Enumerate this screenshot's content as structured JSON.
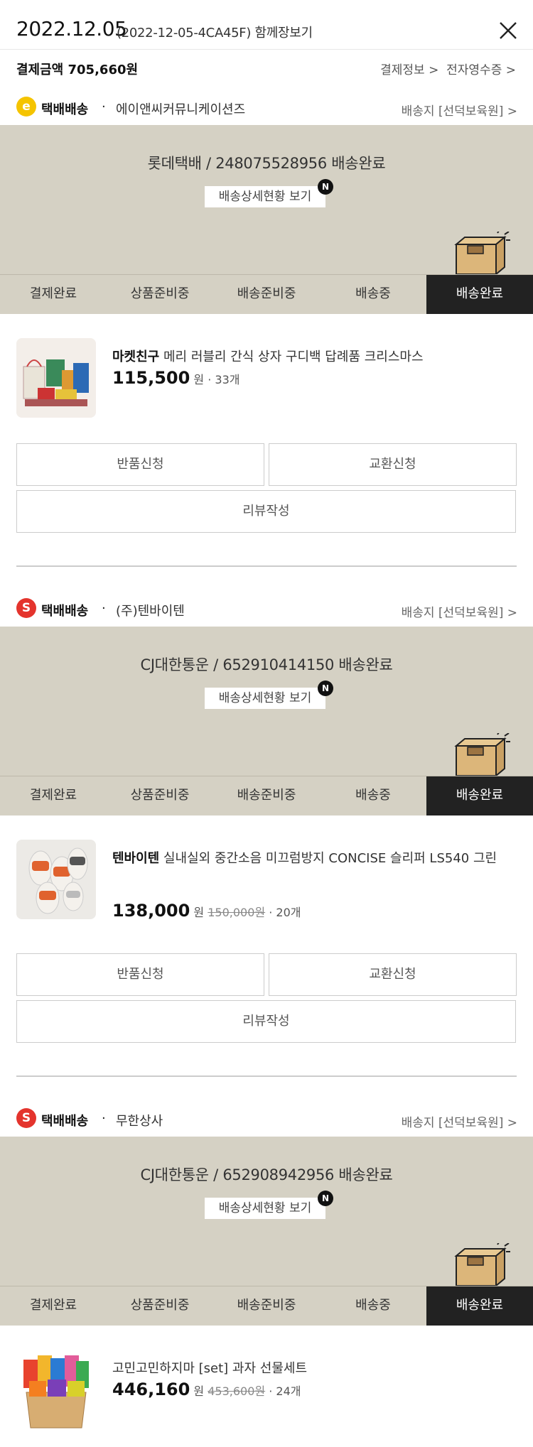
{
  "header": {
    "date": "2022.12.05",
    "order_ref": "(2022-12-05-4CA45F) 함께장보기",
    "pay_amount": "결제금액 705,660원",
    "pay_info_link": "결제정보 >",
    "receipt_link": "전자영수증 >"
  },
  "shipments": [
    {
      "badge": "e",
      "ship_type": "택배배송",
      "dot": "·",
      "vendor": "에이앤씨커뮤니케이션즈",
      "address": "배송지 [선덕보육원] >",
      "courier": "롯데택배 / 248075528956 배송완료",
      "detail_button": "배송상세현황 보기",
      "new_badge": "N",
      "steps": [
        "결제완료",
        "상품준비중",
        "배송준비중",
        "배송중",
        "배송완료"
      ],
      "product": {
        "brand": "마켓친구",
        "name": " 메리 러블리 간식 상자 구디백 답례품 크리스마스",
        "price": "115,500",
        "won": "원",
        "original": "",
        "qty": "· 33개"
      },
      "buttons": {
        "return": "반품신청",
        "exchange": "교환신청",
        "review": "리뷰작성"
      }
    },
    {
      "badge": "S",
      "ship_type": "택배배송",
      "dot": "·",
      "vendor": "(주)텐바이텐",
      "address": "배송지 [선덕보육원] >",
      "courier": "CJ대한통운 / 652910414150 배송완료",
      "detail_button": "배송상세현황 보기",
      "new_badge": "N",
      "steps": [
        "결제완료",
        "상품준비중",
        "배송준비중",
        "배송중",
        "배송완료"
      ],
      "product": {
        "brand": "텐바이텐",
        "name": " 실내실외 중간소음 미끄럼방지 CONCISE 슬리퍼 LS540 그린",
        "price": "138,000",
        "won": "원",
        "original": "150,000원",
        "qty": "· 20개"
      },
      "buttons": {
        "return": "반품신청",
        "exchange": "교환신청",
        "review": "리뷰작성"
      }
    },
    {
      "badge": "S",
      "ship_type": "택배배송",
      "dot": "·",
      "vendor": "무한상사",
      "address": "배송지 [선덕보육원] >",
      "courier": "CJ대한통운 / 652908942956 배송완료",
      "detail_button": "배송상세현황 보기",
      "new_badge": "N",
      "steps": [
        "결제완료",
        "상품준비중",
        "배송준비중",
        "배송중",
        "배송완료"
      ],
      "product": {
        "brand": "",
        "name": "고민고민하지마 [set] 과자 선물세트",
        "price": "446,160",
        "won": "원",
        "original": "453,600원",
        "qty": "· 24개"
      }
    }
  ],
  "colors": {
    "tracking_bg": "#d5d1c4",
    "active_step": "#222222",
    "badge_e": "#f5c400",
    "badge_s": "#e4342d"
  }
}
